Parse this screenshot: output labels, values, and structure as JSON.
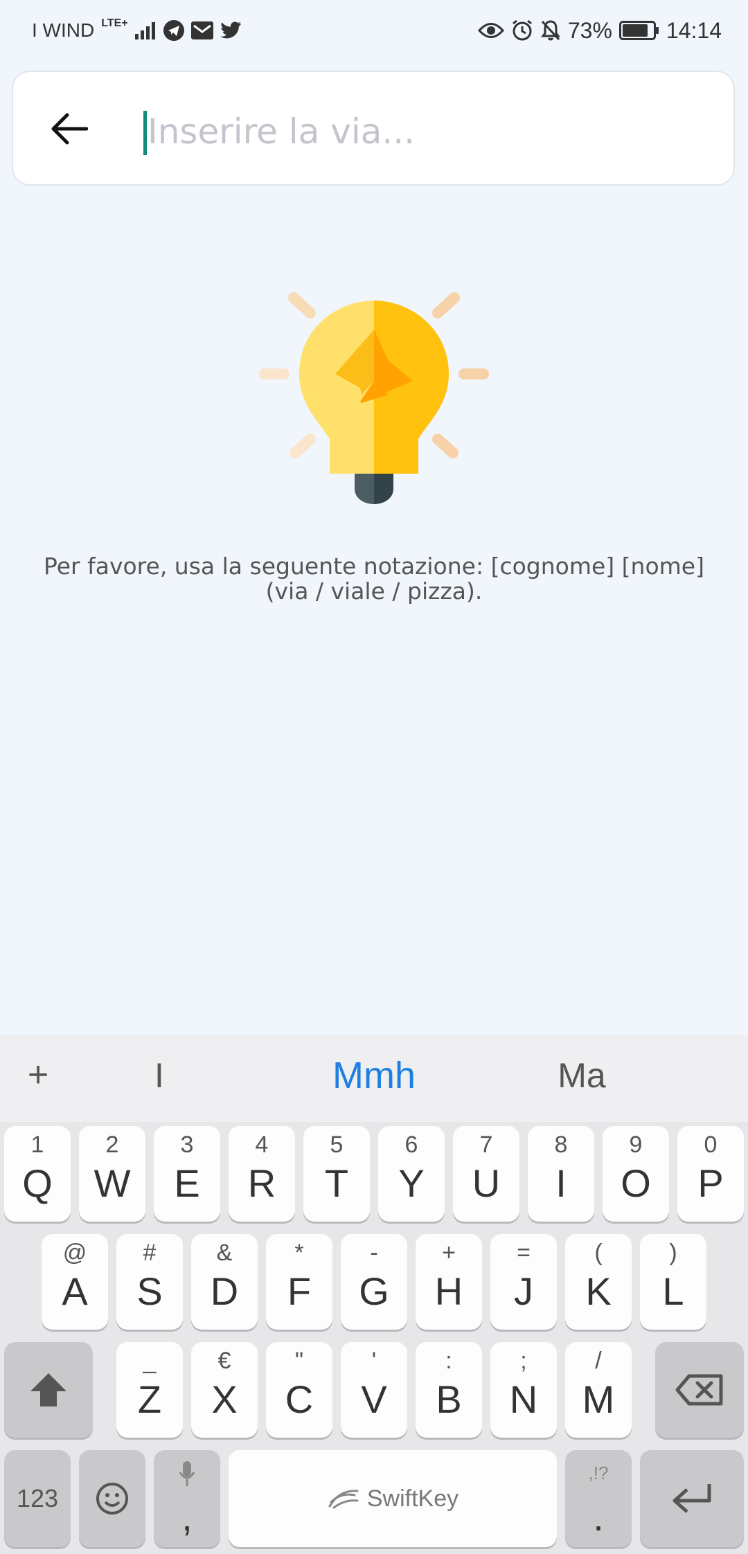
{
  "status_bar": {
    "carrier": "I WIND",
    "network": "LTE+",
    "battery": "73%",
    "time": "14:14"
  },
  "search": {
    "placeholder": "Inserire la via..."
  },
  "info": {
    "text": "Per favore, usa la seguente notazione: [cognome] [nome] (via / viale / pizza)."
  },
  "keyboard": {
    "suggestions": [
      "I",
      "Mmh",
      "Ma"
    ],
    "rows": [
      [
        {
          "p": "Q",
          "s": "1"
        },
        {
          "p": "W",
          "s": "2"
        },
        {
          "p": "E",
          "s": "3"
        },
        {
          "p": "R",
          "s": "4"
        },
        {
          "p": "T",
          "s": "5"
        },
        {
          "p": "Y",
          "s": "6"
        },
        {
          "p": "U",
          "s": "7"
        },
        {
          "p": "I",
          "s": "8"
        },
        {
          "p": "O",
          "s": "9"
        },
        {
          "p": "P",
          "s": "0"
        }
      ],
      [
        {
          "p": "A",
          "s": "@"
        },
        {
          "p": "S",
          "s": "#"
        },
        {
          "p": "D",
          "s": "&"
        },
        {
          "p": "F",
          "s": "*"
        },
        {
          "p": "G",
          "s": "-"
        },
        {
          "p": "H",
          "s": "+"
        },
        {
          "p": "J",
          "s": "="
        },
        {
          "p": "K",
          "s": "("
        },
        {
          "p": "L",
          "s": ")"
        }
      ],
      [
        {
          "p": "Z",
          "s": "_"
        },
        {
          "p": "X",
          "s": "€"
        },
        {
          "p": "C",
          "s": "\""
        },
        {
          "p": "V",
          "s": "'"
        },
        {
          "p": "B",
          "s": ":"
        },
        {
          "p": "N",
          "s": ";"
        },
        {
          "p": "M",
          "s": "/"
        }
      ]
    ],
    "num_label": "123",
    "comma_label": ",",
    "period_label": ".",
    "period_secondary": ",!?",
    "space_label": "SwiftKey",
    "accent_color": "#1e7fe0"
  }
}
